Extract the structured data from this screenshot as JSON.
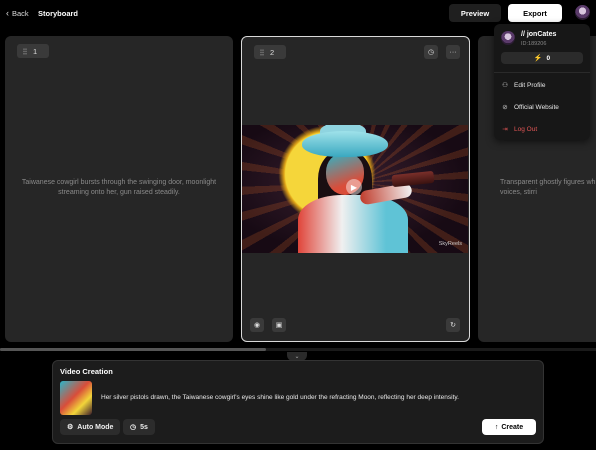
{
  "header": {
    "back_label": "Back",
    "title": "Storyboard",
    "preview_label": "Preview",
    "export_label": "Export"
  },
  "cards": [
    {
      "number": "1",
      "description": "Taiwanese cowgirl bursts through the swinging door, moonlight streaming onto her, gun raised steadily."
    },
    {
      "number": "2",
      "watermark": "SkyReels"
    },
    {
      "description": "Transparent ghostly figures whispering voices, stirri"
    }
  ],
  "video_creation": {
    "title": "Video Creation",
    "prompt": "Her silver pistols drawn, the Taiwanese cowgirl's eyes shine like gold under the refracting Moon, reflecting her deep intensity.",
    "mode_label": "Auto Mode",
    "duration_label": "5s",
    "create_label": "Create"
  },
  "profile_menu": {
    "username": "// jonCates",
    "user_id": "ID:189206",
    "credits": "0",
    "items": [
      {
        "label": "Edit Profile",
        "icon": "user-icon"
      },
      {
        "label": "Official Website",
        "icon": "compass-icon"
      },
      {
        "label": "Log Out",
        "icon": "logout-icon"
      }
    ]
  },
  "colors": {
    "background": "#000000",
    "card": "#262626",
    "accent_logout": "#e25555",
    "credits_bolt": "#f0c020"
  }
}
